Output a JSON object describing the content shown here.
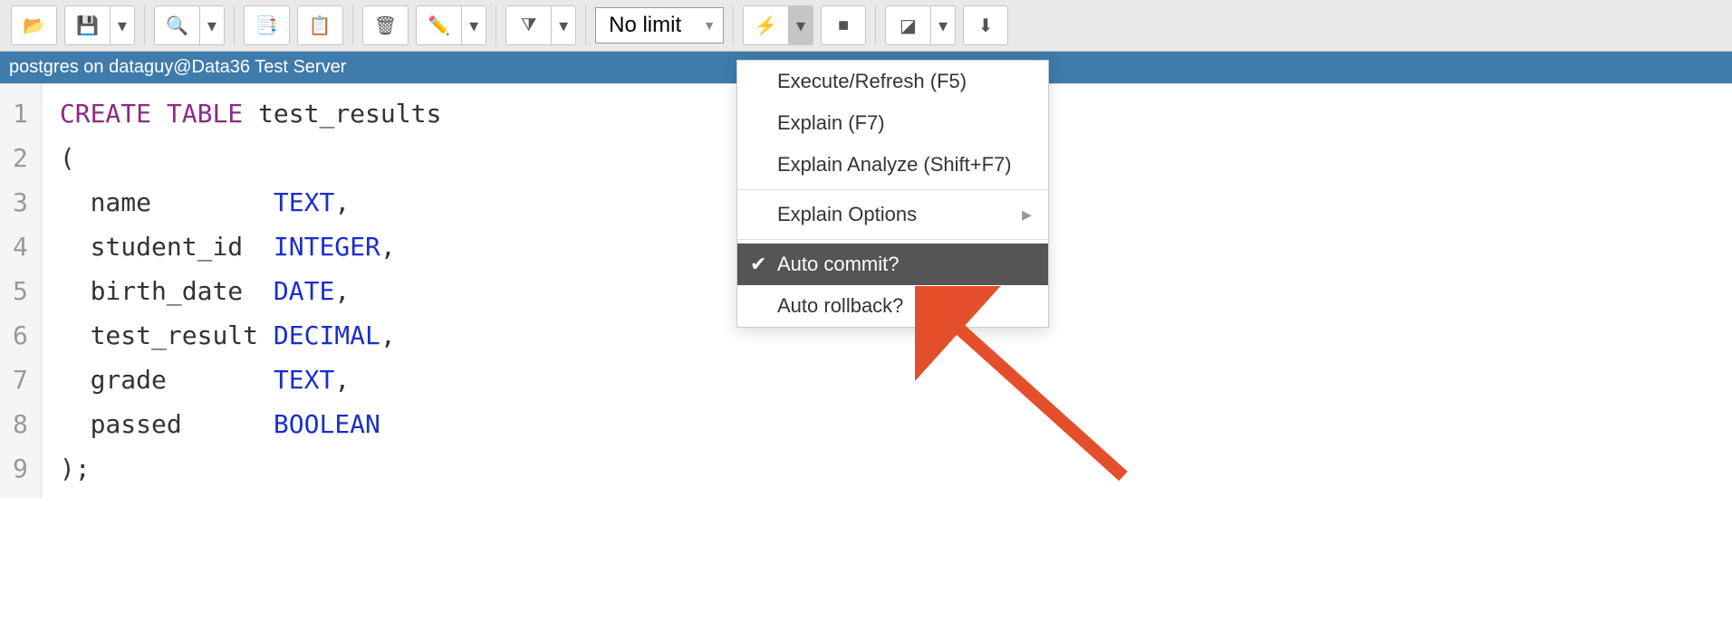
{
  "toolbar": {
    "limit_label": "No limit"
  },
  "connection": {
    "text": "postgres on dataguy@Data36 Test Server"
  },
  "editor": {
    "lines": [
      "1",
      "2",
      "3",
      "4",
      "5",
      "6",
      "7",
      "8",
      "9"
    ],
    "code": [
      {
        "t": "kw",
        "v": "CREATE"
      },
      {
        "t": "sp",
        "v": " "
      },
      {
        "t": "kw",
        "v": "TABLE"
      },
      {
        "t": "sp",
        "v": " "
      },
      {
        "t": "txt",
        "v": "test_results"
      },
      {
        "t": "nl"
      },
      {
        "t": "txt",
        "v": "("
      },
      {
        "t": "nl"
      },
      {
        "t": "sp",
        "v": "  "
      },
      {
        "t": "txt",
        "v": "name"
      },
      {
        "t": "sp",
        "v": "        "
      },
      {
        "t": "type",
        "v": "TEXT"
      },
      {
        "t": "txt",
        "v": ","
      },
      {
        "t": "nl"
      },
      {
        "t": "sp",
        "v": "  "
      },
      {
        "t": "txt",
        "v": "student_id"
      },
      {
        "t": "sp",
        "v": "  "
      },
      {
        "t": "type",
        "v": "INTEGER"
      },
      {
        "t": "txt",
        "v": ","
      },
      {
        "t": "nl"
      },
      {
        "t": "sp",
        "v": "  "
      },
      {
        "t": "txt",
        "v": "birth_date"
      },
      {
        "t": "sp",
        "v": "  "
      },
      {
        "t": "type",
        "v": "DATE"
      },
      {
        "t": "txt",
        "v": ","
      },
      {
        "t": "nl"
      },
      {
        "t": "sp",
        "v": "  "
      },
      {
        "t": "txt",
        "v": "test_result"
      },
      {
        "t": "sp",
        "v": " "
      },
      {
        "t": "type",
        "v": "DECIMAL"
      },
      {
        "t": "txt",
        "v": ","
      },
      {
        "t": "nl"
      },
      {
        "t": "sp",
        "v": "  "
      },
      {
        "t": "txt",
        "v": "grade"
      },
      {
        "t": "sp",
        "v": "       "
      },
      {
        "t": "type",
        "v": "TEXT"
      },
      {
        "t": "txt",
        "v": ","
      },
      {
        "t": "nl"
      },
      {
        "t": "sp",
        "v": "  "
      },
      {
        "t": "txt",
        "v": "passed"
      },
      {
        "t": "sp",
        "v": "      "
      },
      {
        "t": "type",
        "v": "BOOLEAN"
      },
      {
        "t": "nl"
      },
      {
        "t": "txt",
        "v": ");"
      }
    ]
  },
  "menu": {
    "items": [
      {
        "label": "Execute/Refresh (F5)"
      },
      {
        "label": "Explain (F7)"
      },
      {
        "label": "Explain Analyze (Shift+F7)"
      }
    ],
    "explain_options": "Explain Options",
    "auto_commit": "Auto commit?",
    "auto_rollback": "Auto rollback?"
  }
}
